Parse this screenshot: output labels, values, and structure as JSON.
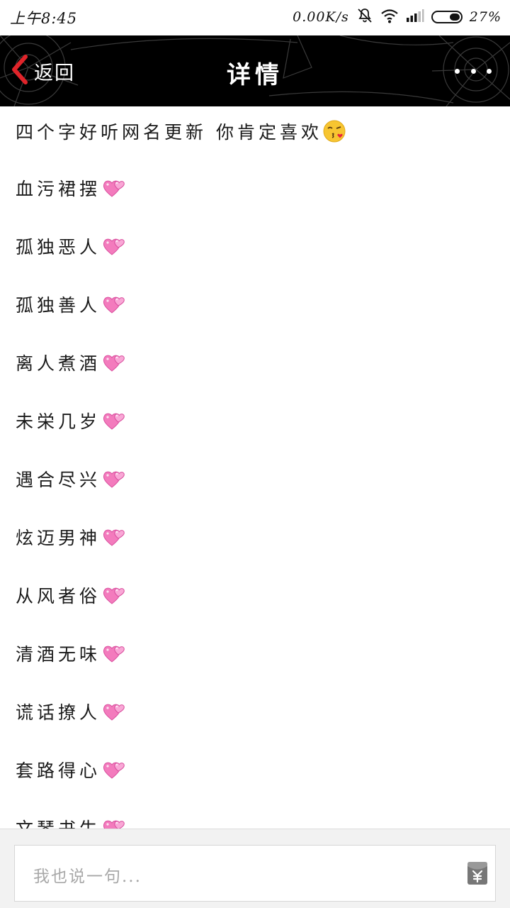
{
  "status_bar": {
    "time": "上午8:45",
    "speed": "0.00K/s",
    "battery_percent": "27%",
    "battery_level": 0.27,
    "icons": [
      "notifications-off-icon",
      "wifi-icon",
      "signal-icon",
      "battery-icon"
    ]
  },
  "header": {
    "back_label": "返回",
    "title": "详情",
    "more_icon": "more-dots-icon",
    "background_color": "#000000",
    "back_icon_color": "#e0242a"
  },
  "content": {
    "intro": "四个字好听网名更新 你肯定喜欢",
    "intro_icon": "kissing-face-emoji",
    "name_icon": "two-hearts-emoji",
    "names": [
      "血污裙摆",
      "孤独恶人",
      "孤独善人",
      "离人煮酒",
      "未栄几岁",
      "遇合尽兴",
      "炫迈男神",
      "从风者俗",
      "清酒无味",
      "谎话撩人",
      "套路得心",
      "文琴书生"
    ]
  },
  "comment_bar": {
    "placeholder": "我也说一句...",
    "reward_icon": "red-envelope-yuan-icon"
  }
}
